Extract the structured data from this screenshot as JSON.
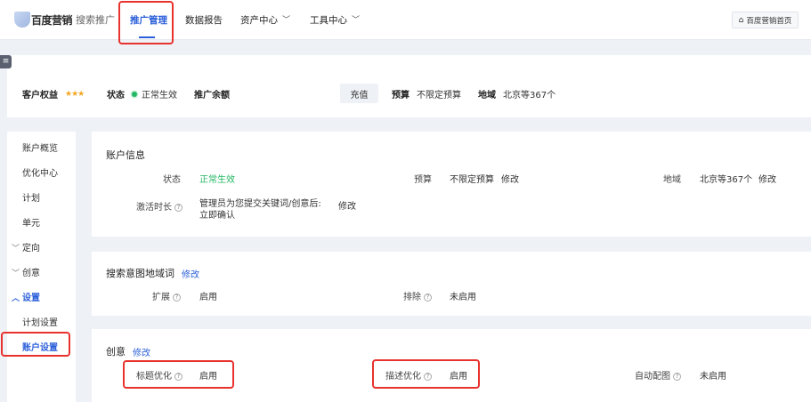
{
  "topnav": {
    "logo_brand": "百度营销",
    "logo_sub": "搜索推广",
    "items": [
      {
        "label": "推广管理",
        "active": true
      },
      {
        "label": "数据报告"
      },
      {
        "label": "资产中心",
        "dropdown": true
      },
      {
        "label": "工具中心",
        "dropdown": true
      }
    ],
    "home_button": "百度营销首页",
    "accent_color": "#2b5fd9"
  },
  "account_bar": {
    "rights_label": "客户权益",
    "rights_stars": "★★★",
    "status_label": "状态",
    "status_value": "正常生效",
    "balance_label": "推广余额",
    "charge_button": "充值",
    "budget_label": "预算",
    "budget_value": "不限定预算",
    "region_label": "地域",
    "region_value": "北京等367个"
  },
  "sidebar": {
    "items": [
      {
        "label": "账户概览"
      },
      {
        "label": "优化中心"
      },
      {
        "label": "计划"
      },
      {
        "label": "单元"
      },
      {
        "label": "定向",
        "group": true
      },
      {
        "label": "创意",
        "group": true
      },
      {
        "label": "设置",
        "group": true,
        "open": true
      },
      {
        "label": "计划设置"
      },
      {
        "label": "账户设置",
        "current": true
      }
    ]
  },
  "account_info": {
    "title": "账户信息",
    "status_label": "状态",
    "status_value": "正常生效",
    "budget_label": "预算",
    "budget_value": "不限定预算",
    "budget_edit": "修改",
    "region_label": "地域",
    "region_value": "北京等367个",
    "region_edit": "修改",
    "activate_label": "激活时长",
    "activate_value_line1": "管理员为您提交关键词/创意后:",
    "activate_value_line2": "立即确认",
    "activate_edit": "修改"
  },
  "search_intent": {
    "title": "搜索意图地域词",
    "edit": "修改",
    "expand_label": "扩展",
    "expand_value": "启用",
    "exclude_label": "排除",
    "exclude_value": "未启用"
  },
  "creative": {
    "title": "创意",
    "edit": "修改",
    "title_opt_label": "标题优化",
    "title_opt_value": "启用",
    "desc_opt_label": "描述优化",
    "desc_opt_value": "启用",
    "auto_img_label": "自动配图",
    "auto_img_value": "未启用"
  },
  "colors": {
    "accent": "#2b5fd9",
    "success": "#25b864",
    "highlight": "#e8322d",
    "star": "#f5a623"
  }
}
